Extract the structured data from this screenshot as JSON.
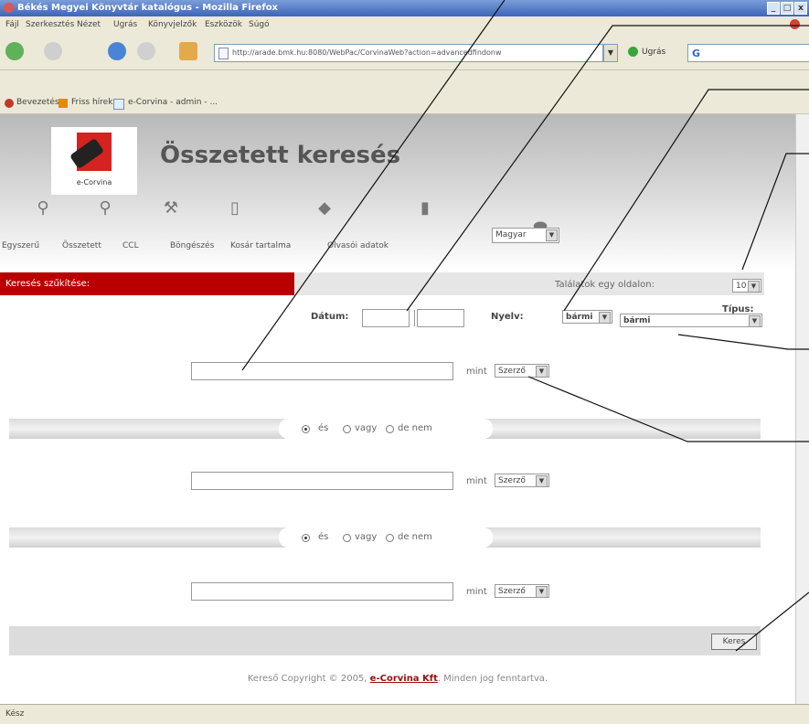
{
  "window": {
    "title": "Békés Megyei Könyvtár katalógus - Mozilla Firefox"
  },
  "menu": [
    "Fájl",
    "Szerkesztés",
    "Nézet",
    "Ugrás",
    "Könyvjelzők",
    "Eszközök",
    "Súgó"
  ],
  "toolbar": {
    "address": "http://arade.bmk.hu:8080/WebPac/CorvinaWeb?action=advancedfindonw",
    "go_label": "Ugrás",
    "search_glyph": "G"
  },
  "bookmarks": [
    "Bevezetés",
    "Friss hírek",
    "e-Corvina - admin - ..."
  ],
  "page": {
    "logo_text": "e-Corvina",
    "title": "Összetett keresés",
    "nav": [
      "Egyszerű",
      "Összetett",
      "CCL",
      "Böngészés",
      "Kosár tartalma",
      "Olvasói adatok"
    ],
    "language": "Magyar",
    "narrow_label": "Keresés szűkítése:",
    "per_page_label": "Találatok egy oldalon:",
    "per_page_value": "10",
    "date_label": "Dátum:",
    "date_from": "",
    "date_to": "",
    "lang_label": "Nyelv:",
    "lang_value": "bármi",
    "type_label": "Típus:",
    "type_value": "bármi",
    "rows": [
      {
        "query": "",
        "mint": "mint",
        "field": "Szerző"
      },
      {
        "query": "",
        "mint": "mint",
        "field": "Szerző"
      },
      {
        "query": "",
        "mint": "mint",
        "field": "Szerző"
      }
    ],
    "operators": [
      {
        "opt1": "és",
        "opt2": "vagy",
        "opt3": "de nem",
        "selected": "és"
      },
      {
        "opt1": "és",
        "opt2": "vagy",
        "opt3": "de nem",
        "selected": "és"
      }
    ],
    "search_button": "Keres",
    "footer_prefix": "Kereső Copyright © 2005,",
    "footer_link": "e-Corvina Kft",
    "footer_suffix": ". Minden jog fenntartva."
  },
  "status": "Kész",
  "colors": {
    "accent_red": "#b90000",
    "titlebar": "#3d64b9",
    "chrome": "#ece9d8"
  }
}
